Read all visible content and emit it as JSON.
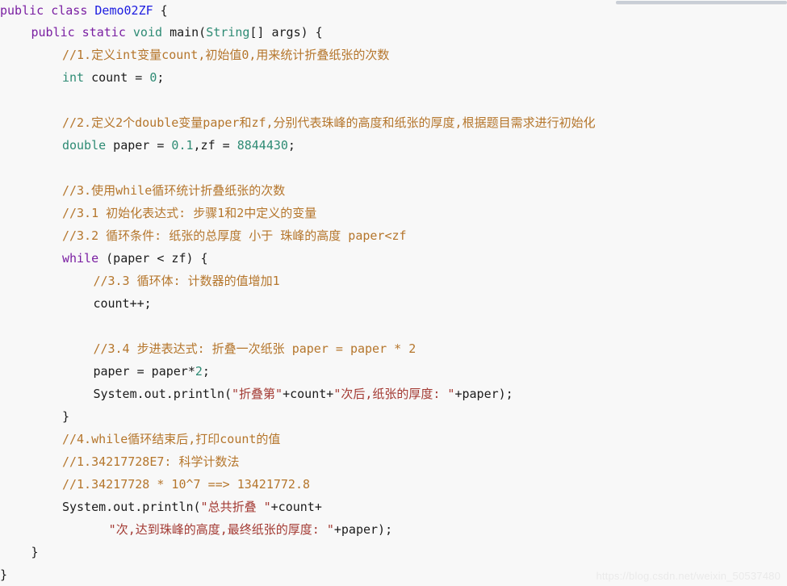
{
  "editor": {
    "language": "java",
    "background_color": "#f8f8f8",
    "colors": {
      "keyword": "#7a1fa2",
      "type": "#2e8b74",
      "class_name": "#1c1ce0",
      "number": "#2e8b74",
      "comment": "#b5762c",
      "string": "#a33a33",
      "plain": "#1b1b1b"
    }
  },
  "scrollbar": {
    "orientation": "horizontal",
    "name": "horizontal-scrollbar"
  },
  "watermark": {
    "text": "https://blog.csdn.net/weixin_50537480"
  },
  "code": {
    "lines": [
      {
        "indent": 0,
        "tokens": [
          {
            "t": "kw",
            "v": "public class "
          },
          {
            "t": "cls",
            "v": "Demo02ZF"
          },
          {
            "t": "pl",
            "v": " {"
          }
        ]
      },
      {
        "indent": 4,
        "tokens": [
          {
            "t": "kw",
            "v": "public static "
          },
          {
            "t": "typ",
            "v": "void "
          },
          {
            "t": "pl",
            "v": "main("
          },
          {
            "t": "typ",
            "v": "String"
          },
          {
            "t": "pl",
            "v": "[] args) {"
          }
        ]
      },
      {
        "indent": 8,
        "tokens": [
          {
            "t": "cmt",
            "v": "//1.定义int变量count,初始值0,用来统计折叠纸张的次数"
          }
        ]
      },
      {
        "indent": 8,
        "tokens": [
          {
            "t": "typ",
            "v": "int "
          },
          {
            "t": "pl",
            "v": "count = "
          },
          {
            "t": "num",
            "v": "0"
          },
          {
            "t": "pl",
            "v": ";"
          }
        ]
      },
      {
        "indent": 0,
        "tokens": []
      },
      {
        "indent": 8,
        "tokens": [
          {
            "t": "cmt",
            "v": "//2.定义2个double变量paper和zf,分别代表珠峰的高度和纸张的厚度,根据题目需求进行初始化"
          }
        ]
      },
      {
        "indent": 8,
        "tokens": [
          {
            "t": "typ",
            "v": "double "
          },
          {
            "t": "pl",
            "v": "paper = "
          },
          {
            "t": "num",
            "v": "0.1"
          },
          {
            "t": "pl",
            "v": ",zf = "
          },
          {
            "t": "num",
            "v": "8844430"
          },
          {
            "t": "pl",
            "v": ";"
          }
        ]
      },
      {
        "indent": 0,
        "tokens": []
      },
      {
        "indent": 8,
        "tokens": [
          {
            "t": "cmt",
            "v": "//3.使用while循环统计折叠纸张的次数"
          }
        ]
      },
      {
        "indent": 8,
        "tokens": [
          {
            "t": "cmt",
            "v": "//3.1 初始化表达式: 步骤1和2中定义的变量"
          }
        ]
      },
      {
        "indent": 8,
        "tokens": [
          {
            "t": "cmt",
            "v": "//3.2 循环条件: 纸张的总厚度 小于 珠峰的高度 paper<zf"
          }
        ]
      },
      {
        "indent": 8,
        "tokens": [
          {
            "t": "kw",
            "v": "while "
          },
          {
            "t": "pl",
            "v": "(paper < zf) {"
          }
        ]
      },
      {
        "indent": 12,
        "tokens": [
          {
            "t": "cmt",
            "v": "//3.3 循环体: 计数器的值增加1"
          }
        ]
      },
      {
        "indent": 12,
        "tokens": [
          {
            "t": "pl",
            "v": "count++;"
          }
        ]
      },
      {
        "indent": 0,
        "tokens": []
      },
      {
        "indent": 12,
        "tokens": [
          {
            "t": "cmt",
            "v": "//3.4 步进表达式: 折叠一次纸张 paper = paper * 2"
          }
        ]
      },
      {
        "indent": 12,
        "tokens": [
          {
            "t": "pl",
            "v": "paper = paper*"
          },
          {
            "t": "num",
            "v": "2"
          },
          {
            "t": "pl",
            "v": ";"
          }
        ]
      },
      {
        "indent": 12,
        "tokens": [
          {
            "t": "pl",
            "v": "System.out.println("
          },
          {
            "t": "str",
            "v": "\"折叠第\""
          },
          {
            "t": "pl",
            "v": "+count+"
          },
          {
            "t": "str",
            "v": "\"次后,纸张的厚度: \""
          },
          {
            "t": "pl",
            "v": "+paper);"
          }
        ]
      },
      {
        "indent": 8,
        "tokens": [
          {
            "t": "pl",
            "v": "}"
          }
        ]
      },
      {
        "indent": 8,
        "tokens": [
          {
            "t": "cmt",
            "v": "//4.while循环结束后,打印count的值"
          }
        ]
      },
      {
        "indent": 8,
        "tokens": [
          {
            "t": "cmt",
            "v": "//1.34217728E7: 科学计数法"
          }
        ]
      },
      {
        "indent": 8,
        "tokens": [
          {
            "t": "cmt",
            "v": "//1.34217728 * 10^7 ==> 13421772.8"
          }
        ]
      },
      {
        "indent": 8,
        "tokens": [
          {
            "t": "pl",
            "v": "System.out.println("
          },
          {
            "t": "str",
            "v": "\"总共折叠 \""
          },
          {
            "t": "pl",
            "v": "+count+"
          }
        ]
      },
      {
        "indent": 14,
        "tokens": [
          {
            "t": "str",
            "v": "\"次,达到珠峰的高度,最终纸张的厚度: \""
          },
          {
            "t": "pl",
            "v": "+paper);"
          }
        ]
      },
      {
        "indent": 4,
        "tokens": [
          {
            "t": "pl",
            "v": "}"
          }
        ]
      },
      {
        "indent": 0,
        "tokens": [
          {
            "t": "pl",
            "v": "}"
          }
        ]
      }
    ]
  }
}
